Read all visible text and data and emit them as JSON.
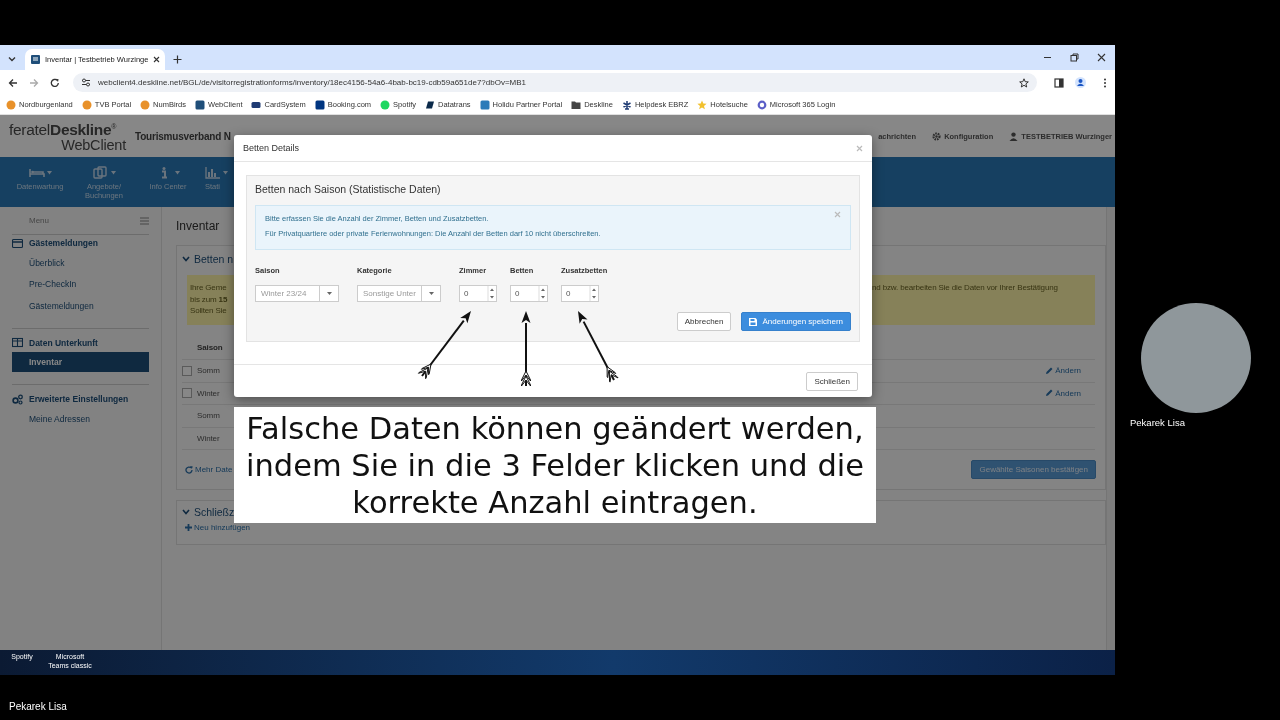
{
  "browser": {
    "tab_title": "Inventar | Testbetrieb Wurzinge",
    "url": "webclient4.deskline.net/BGL/de/visitorregistrationforms/inventory/18ec4156-54a6-4bab-bc19-cdb59a651de7?dbOv=MB1",
    "bookmarks": [
      {
        "label": "Nordburgenland",
        "kind": "circle",
        "color": "#e8912a"
      },
      {
        "label": "TVB Portal",
        "kind": "circle",
        "color": "#e8912a"
      },
      {
        "label": "NumBirds",
        "kind": "circle",
        "color": "#e8912a"
      },
      {
        "label": "WebClient",
        "kind": "square",
        "color": "#1f4e79"
      },
      {
        "label": "CardSystem",
        "kind": "card",
        "color": "#1f3b73"
      },
      {
        "label": "Booking.com",
        "kind": "square",
        "color": "#003580"
      },
      {
        "label": "Spotify",
        "kind": "circle",
        "color": "#1ed760"
      },
      {
        "label": "Datatrans",
        "kind": "flag",
        "color": "#0b2a4a"
      },
      {
        "label": "Holidu Partner Portal",
        "kind": "square",
        "color": "#2b7bb9"
      },
      {
        "label": "Deskline",
        "kind": "folder",
        "color": "#444444"
      },
      {
        "label": "Helpdesk EBRZ",
        "kind": "figure",
        "color": "#1f3b73"
      },
      {
        "label": "Hotelsuche",
        "kind": "star",
        "color": "#f2c12e"
      },
      {
        "label": "Microsoft 365 Login",
        "kind": "ring",
        "color": "#5b5fc7"
      }
    ]
  },
  "app": {
    "logo": "feratel**Deskline**$^{®}$",
    "logo_sub": "WebClient",
    "organization": "Tourismusverband N",
    "header_links": [
      {
        "label": "achrichten",
        "kind": "plain"
      },
      {
        "label": "Konfiguration",
        "kind": "gear"
      },
      {
        "label": "TESTBETRIEB Wurzinger",
        "kind": "user"
      }
    ],
    "nav": [
      {
        "label": "Datenwartung",
        "kind": "bed"
      },
      {
        "label": "Angebote/ Buchungen",
        "kind": "copy"
      },
      {
        "label": "Info Center",
        "kind": "info"
      },
      {
        "label": "Stati",
        "kind": "chart"
      }
    ],
    "sidebar": {
      "title": "Menu",
      "groups": [
        {
          "label": "Gästemeldungen",
          "kind": "card",
          "children": [
            {
              "label": "Überblick",
              "selected": false
            },
            {
              "label": "Pre-CheckIn",
              "selected": false
            },
            {
              "label": "Gästemeldungen",
              "selected": false
            }
          ]
        },
        {
          "label": "Daten Unterkunft",
          "kind": "columns",
          "children": [
            {
              "label": "Inventar",
              "selected": true
            }
          ]
        },
        {
          "label": "Erweiterte Einstellungen",
          "kind": "gears",
          "children": [
            {
              "label": "Meine Adressen",
              "selected": false
            }
          ]
        }
      ]
    },
    "page_title": "Inventar",
    "beds_section": {
      "heading": "Betten n",
      "notice_left": [
        "Ihre Geme",
        "bis zum **15**",
        "Sollten Sie"
      ],
      "notice_right": "nd bzw. bearbeiten Sie die Daten vor Ihrer Bestätigung",
      "column_1": "Saison",
      "rows": [
        {
          "season": "Somm",
          "kind": "editable",
          "checked": false,
          "action": "Ändern"
        },
        {
          "season": "Winter",
          "kind": "editable",
          "checked": false,
          "action": "Ändern"
        },
        {
          "season": "Somm",
          "kind": "detail"
        },
        {
          "season": "Winter",
          "kind": "detail"
        }
      ],
      "more_link": "Mehr Date",
      "confirm_button": "Gewählte Saisonen bestätigen"
    },
    "closures_section": {
      "heading": "Schließz",
      "add_link": "Neu hinzufügen"
    }
  },
  "modal": {
    "title": "Betten Details",
    "panel_heading": "Betten nach Saison (Statistische Daten)",
    "notice": [
      "Bitte erfassen Sie die Anzahl der Zimmer, Betten und Zusatzbetten.",
      "Für Privatquartiere oder private Ferienwohnungen: Die Anzahl der Betten darf 10 nicht überschreiten."
    ],
    "columns": [
      "Saison",
      "Kategorie",
      "Zimmer",
      "Betten",
      "Zusatzbetten"
    ],
    "fields": [
      {
        "kind": "select",
        "value": "Winter 23/24",
        "disabled": true
      },
      {
        "kind": "select",
        "value": "Sonstige Unter",
        "disabled": true
      },
      {
        "kind": "number",
        "value": "0"
      },
      {
        "kind": "number",
        "value": "0"
      },
      {
        "kind": "number",
        "value": "0"
      }
    ],
    "cancel_button": "Abbrechen",
    "save_button": "Änderungen speichern",
    "close_button": "Schließen"
  },
  "caption": "Falsche Daten können geändert werden, indem Sie in die 3 Felder klicken und die korrekte Anzahl eintragen.",
  "taskbar": [
    "Spotify",
    "Microsoft Teams classic"
  ],
  "meeting": {
    "participant": "Pekarek Lisa",
    "presenter": "Pekarek Lisa"
  }
}
